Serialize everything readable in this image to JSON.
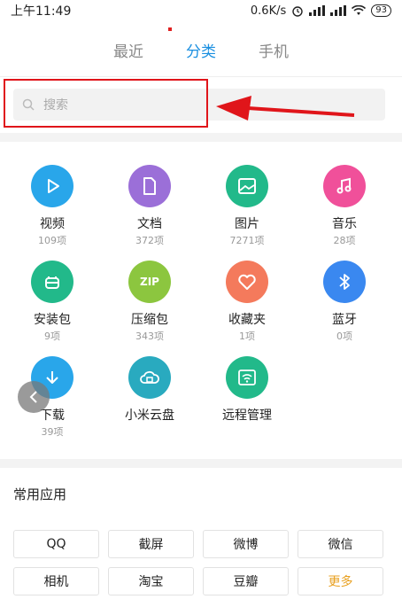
{
  "status_bar": {
    "time": "上午11:49",
    "speed": "0.6K/s",
    "signal1": "ull",
    "battery": "93"
  },
  "tabs": [
    {
      "label": "最近",
      "active": false
    },
    {
      "label": "分类",
      "active": true
    },
    {
      "label": "手机",
      "active": false
    }
  ],
  "search": {
    "placeholder": "搜索"
  },
  "categories": [
    {
      "label": "视频",
      "count": "109项",
      "color": "#29a6ea",
      "icon": "play-icon"
    },
    {
      "label": "文档",
      "count": "372项",
      "color": "#9b6fd8",
      "icon": "document-icon"
    },
    {
      "label": "图片",
      "count": "7271项",
      "color": "#22b98a",
      "icon": "image-icon"
    },
    {
      "label": "音乐",
      "count": "28项",
      "color": "#f0509a",
      "icon": "music-icon"
    },
    {
      "label": "安装包",
      "count": "9项",
      "color": "#22b98a",
      "icon": "package-icon"
    },
    {
      "label": "压缩包",
      "count": "343项",
      "color": "#8cc63f",
      "icon": "zip-icon",
      "icon_text": "ZIP"
    },
    {
      "label": "收藏夹",
      "count": "1项",
      "color": "#f47a5c",
      "icon": "heart-icon"
    },
    {
      "label": "蓝牙",
      "count": "0项",
      "color": "#3a88f0",
      "icon": "bluetooth-icon"
    },
    {
      "label": "下载",
      "count": "39项",
      "color": "#29a6ea",
      "icon": "download-icon"
    },
    {
      "label": "小米云盘",
      "count": "",
      "color": "#29aabf",
      "icon": "cloud-drive-icon"
    },
    {
      "label": "远程管理",
      "count": "",
      "color": "#22b98a",
      "icon": "remote-wifi-icon"
    }
  ],
  "common_apps": {
    "title": "常用应用",
    "items": [
      "QQ",
      "截屏",
      "微博",
      "微信",
      "相机",
      "淘宝",
      "豆瓣",
      "更多"
    ]
  }
}
